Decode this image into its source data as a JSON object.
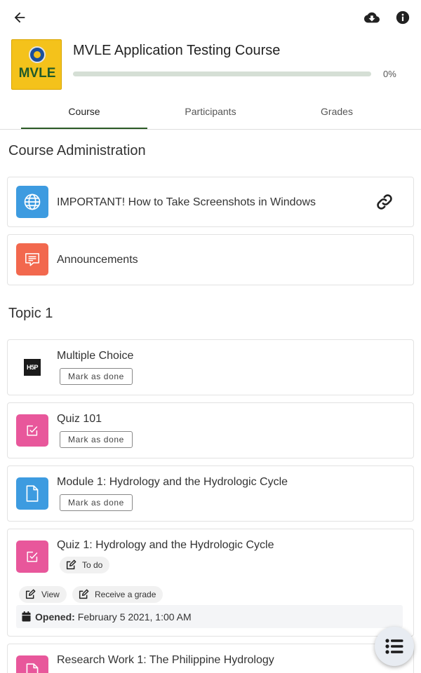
{
  "course": {
    "title": "MVLE Application Testing Course",
    "logo_text": "MVLE",
    "progress_percent": 0,
    "progress_label": "0%"
  },
  "tabs": [
    {
      "label": "Course",
      "active": true
    },
    {
      "label": "Participants",
      "active": false
    },
    {
      "label": "Grades",
      "active": false
    }
  ],
  "sections": [
    {
      "title": "Course Administration",
      "modules": [
        {
          "title": "IMPORTANT! How to Take Screenshots in Windows",
          "icon": "globe-icon",
          "action_icon": "link-icon"
        },
        {
          "title": "Announcements",
          "icon": "forum-icon"
        }
      ]
    },
    {
      "title": "Topic 1",
      "modules": [
        {
          "title": "Multiple Choice",
          "icon": "h5p-icon",
          "icon_text": "H5P",
          "button": "Mark as done"
        },
        {
          "title": "Quiz 101",
          "icon": "quiz-icon",
          "button": "Mark as done"
        },
        {
          "title": "Module 1: Hydrology and the Hydrologic Cycle",
          "icon": "page-icon",
          "button": "Mark as done"
        },
        {
          "title": "Quiz 1: Hydrology and the Hydrologic Cycle",
          "icon": "quiz-icon",
          "status": "To do",
          "chips": [
            "View",
            "Receive a grade"
          ],
          "opened_label": "Opened:",
          "opened_date": "February 5 2021, 1:00 AM"
        },
        {
          "title": "Research Work 1: The Philippine Hydrology",
          "icon": "assignment-icon"
        }
      ]
    }
  ],
  "colors": {
    "accent": "#2b5a25",
    "progress_track": "#d5dfd5",
    "url_icon": "#3d9be0",
    "forum_icon": "#f2684e",
    "quiz_icon": "#e8579b",
    "page_icon": "#3d9be0",
    "logo_bg": "#f4c21b"
  }
}
